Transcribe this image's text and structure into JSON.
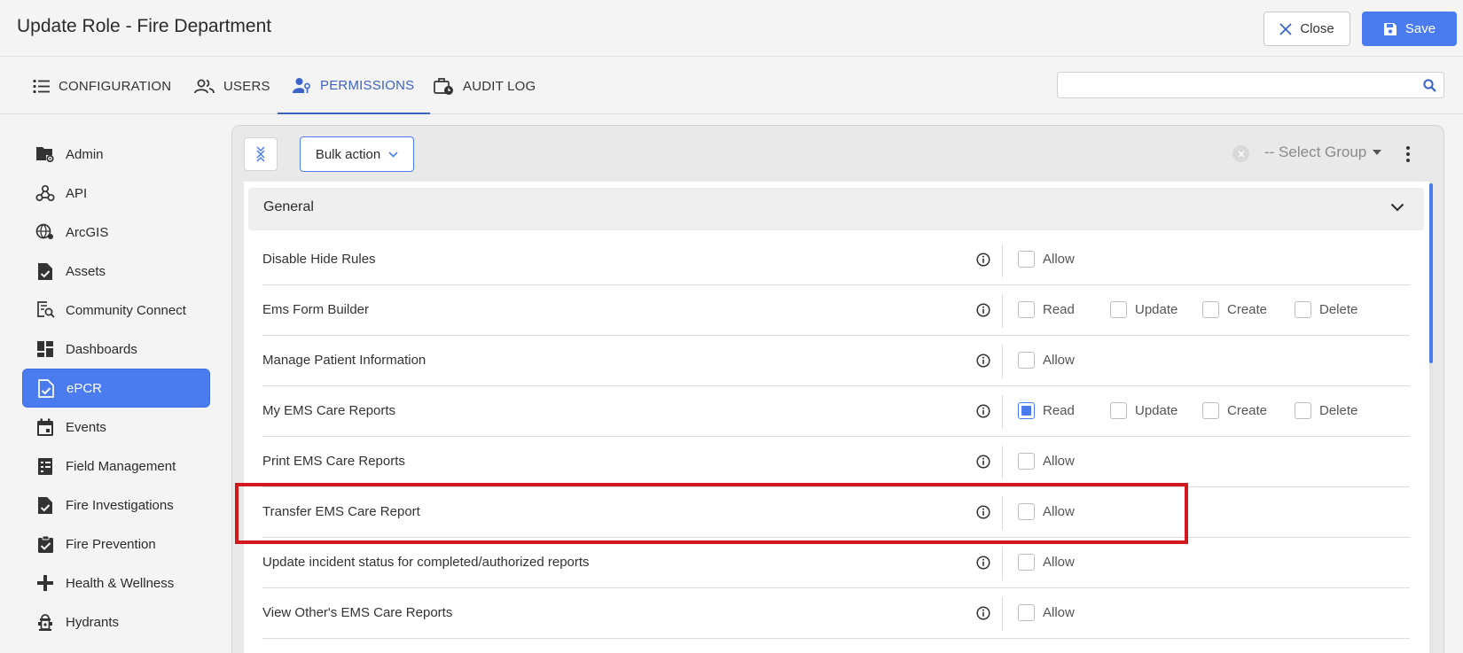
{
  "header": {
    "title": "Update Role - Fire Department",
    "close_label": "Close",
    "save_label": "Save"
  },
  "tabs": [
    {
      "label": "CONFIGURATION",
      "icon": "list-icon",
      "active": false
    },
    {
      "label": "USERS",
      "icon": "users-icon",
      "active": false
    },
    {
      "label": "PERMISSIONS",
      "icon": "user-key-icon",
      "active": true
    },
    {
      "label": "AUDIT LOG",
      "icon": "briefcase-clock-icon",
      "active": false
    }
  ],
  "search": {
    "value": "",
    "placeholder": ""
  },
  "sidebar": {
    "items": [
      {
        "label": "Admin",
        "icon": "folder-gear-icon",
        "active": false
      },
      {
        "label": "API",
        "icon": "webhook-icon",
        "active": false
      },
      {
        "label": "ArcGIS",
        "icon": "globe-gear-icon",
        "active": false
      },
      {
        "label": "Assets",
        "icon": "document-check-icon",
        "active": false
      },
      {
        "label": "Community Connect",
        "icon": "search-document-icon",
        "active": false
      },
      {
        "label": "Dashboards",
        "icon": "dashboard-icon",
        "active": false
      },
      {
        "label": "ePCR",
        "icon": "document-check-icon",
        "active": true
      },
      {
        "label": "Events",
        "icon": "calendar-icon",
        "active": false
      },
      {
        "label": "Field Management",
        "icon": "form-icon",
        "active": false
      },
      {
        "label": "Fire Investigations",
        "icon": "document-check-icon",
        "active": false
      },
      {
        "label": "Fire Prevention",
        "icon": "clipboard-check-icon",
        "active": false
      },
      {
        "label": "Health & Wellness",
        "icon": "plus-icon",
        "active": false
      },
      {
        "label": "Hydrants",
        "icon": "hydrant-icon",
        "active": false
      }
    ]
  },
  "toolbar": {
    "bulk_action_label": "Bulk action",
    "select_group_label": "-- Select Group"
  },
  "section": {
    "title": "General"
  },
  "permission_rows": [
    {
      "label": "Disable Hide Rules",
      "options": [
        {
          "label": "Allow",
          "checked": false
        }
      ]
    },
    {
      "label": "Ems Form Builder",
      "options": [
        {
          "label": "Read",
          "checked": false
        },
        {
          "label": "Update",
          "checked": false
        },
        {
          "label": "Create",
          "checked": false
        },
        {
          "label": "Delete",
          "checked": false
        }
      ]
    },
    {
      "label": "Manage Patient Information",
      "options": [
        {
          "label": "Allow",
          "checked": false
        }
      ]
    },
    {
      "label": "My EMS Care Reports",
      "options": [
        {
          "label": "Read",
          "checked": true
        },
        {
          "label": "Update",
          "checked": false
        },
        {
          "label": "Create",
          "checked": false
        },
        {
          "label": "Delete",
          "checked": false
        }
      ]
    },
    {
      "label": "Print EMS Care Reports",
      "options": [
        {
          "label": "Allow",
          "checked": false
        }
      ]
    },
    {
      "label": "Transfer EMS Care Report",
      "options": [
        {
          "label": "Allow",
          "checked": false
        }
      ]
    },
    {
      "label": "Update incident status for completed/authorized reports",
      "options": [
        {
          "label": "Allow",
          "checked": false
        }
      ]
    },
    {
      "label": "View Other's EMS Care Reports",
      "options": [
        {
          "label": "Allow",
          "checked": false
        }
      ]
    }
  ],
  "colors": {
    "accent": "#4a7cf0",
    "active_tab": "#3b64c7",
    "highlight": "#d2171d"
  }
}
